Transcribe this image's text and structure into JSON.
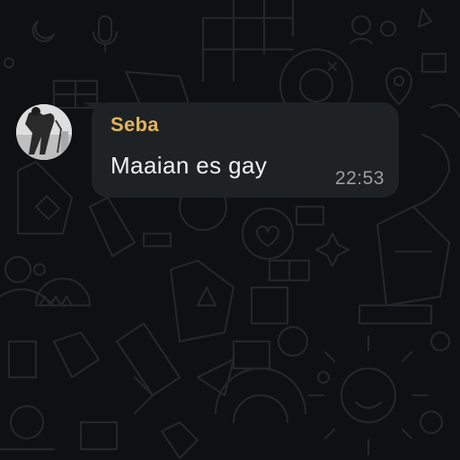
{
  "chat": {
    "background_color": "#0e1011",
    "messages": [
      {
        "sender": "Seba",
        "text": "Maaian es gay",
        "time": "22:53",
        "sender_color": "#e2b45b",
        "bubble_color": "#1f2225"
      }
    ]
  }
}
